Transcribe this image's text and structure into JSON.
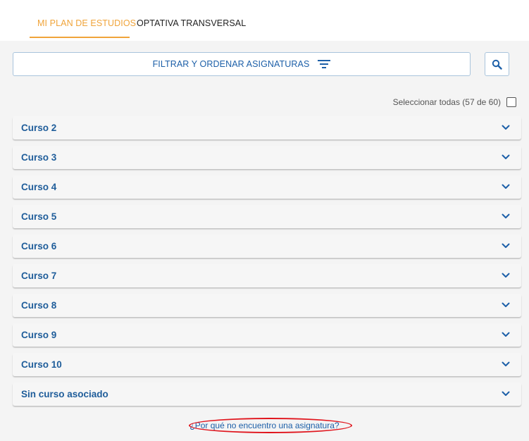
{
  "tabs": [
    {
      "label": "MI PLAN DE ESTUDIOS",
      "active": true
    },
    {
      "label": "OPTATIVA TRANSVERSAL",
      "active": false
    }
  ],
  "filter": {
    "label": "FILTRAR Y ORDENAR ASIGNATURAS",
    "icon": "filter-icon"
  },
  "search": {
    "icon": "search-icon"
  },
  "select_all": {
    "label": "Seleccionar todas (57 de 60)",
    "checked": false
  },
  "courses": [
    {
      "label": "Curso 2"
    },
    {
      "label": "Curso 3"
    },
    {
      "label": "Curso 4"
    },
    {
      "label": "Curso 5"
    },
    {
      "label": "Curso 6"
    },
    {
      "label": "Curso 7"
    },
    {
      "label": "Curso 8"
    },
    {
      "label": "Curso 9"
    },
    {
      "label": "Curso 10"
    },
    {
      "label": "Sin curso asociado"
    }
  ],
  "help_link": {
    "label": "¿Por qué no encuentro una asignatura?"
  },
  "colors": {
    "accent": "#f0a43a",
    "primary": "#1c5fa8",
    "annotation": "#e0141c"
  }
}
